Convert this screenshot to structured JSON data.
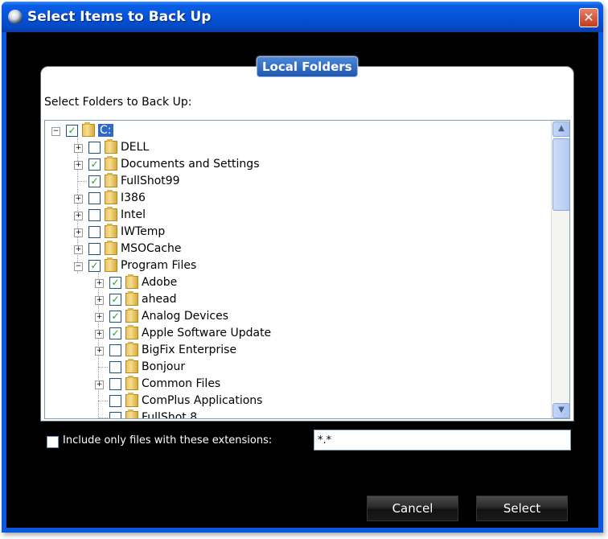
{
  "window": {
    "title": "Select Items to Back Up",
    "close_glyph": "✕"
  },
  "panel": {
    "tab_label": "Local Folders",
    "folders_label": "Select Folders to Back Up:"
  },
  "tree": {
    "root": {
      "label": "C:",
      "checked": true,
      "expanded": true
    },
    "items": [
      {
        "label": "DELL",
        "level": 1,
        "checked": false,
        "expander": "+"
      },
      {
        "label": "Documents and Settings",
        "level": 1,
        "checked": true,
        "expander": "+"
      },
      {
        "label": "FullShot99",
        "level": 1,
        "checked": true,
        "expander": ""
      },
      {
        "label": "I386",
        "level": 1,
        "checked": false,
        "expander": "+"
      },
      {
        "label": "Intel",
        "level": 1,
        "checked": false,
        "expander": "+"
      },
      {
        "label": "IWTemp",
        "level": 1,
        "checked": false,
        "expander": "+"
      },
      {
        "label": "MSOCache",
        "level": 1,
        "checked": false,
        "expander": "+"
      },
      {
        "label": "Program Files",
        "level": 1,
        "checked": true,
        "expander": "-"
      },
      {
        "label": "Adobe",
        "level": 2,
        "checked": true,
        "expander": "+"
      },
      {
        "label": "ahead",
        "level": 2,
        "checked": true,
        "expander": "+"
      },
      {
        "label": "Analog Devices",
        "level": 2,
        "checked": true,
        "expander": "+"
      },
      {
        "label": "Apple Software Update",
        "level": 2,
        "checked": true,
        "expander": "+"
      },
      {
        "label": "BigFix Enterprise",
        "level": 2,
        "checked": false,
        "expander": "+"
      },
      {
        "label": "Bonjour",
        "level": 2,
        "checked": false,
        "expander": ""
      },
      {
        "label": "Common Files",
        "level": 2,
        "checked": false,
        "expander": "+"
      },
      {
        "label": "ComPlus Applications",
        "level": 2,
        "checked": false,
        "expander": ""
      },
      {
        "label": "FullShot 8",
        "level": 2,
        "checked": false,
        "expander": ""
      }
    ]
  },
  "scrollbar": {
    "up_glyph": "▲",
    "down_glyph": "▼"
  },
  "filter": {
    "checked": false,
    "label": "Include only files with these extensions:",
    "value": "*.*"
  },
  "buttons": {
    "cancel": "Cancel",
    "select": "Select"
  },
  "colors": {
    "titlebar": "#0553d8",
    "selection": "#316ac5",
    "check": "#21a121",
    "client_bg": "#000000"
  }
}
